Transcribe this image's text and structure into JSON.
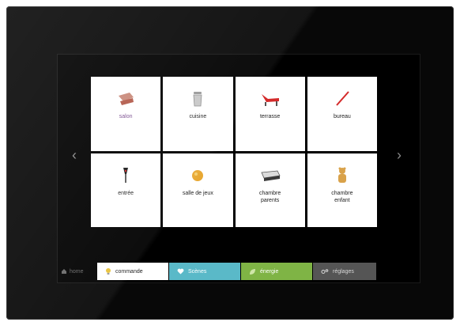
{
  "home": {
    "label": "home"
  },
  "tiles": [
    {
      "label": "salon",
      "icon": "sofa-icon"
    },
    {
      "label": "cuisine",
      "icon": "trash-bin-icon"
    },
    {
      "label": "terrasse",
      "icon": "lounge-chair-icon"
    },
    {
      "label": "bureau",
      "icon": "pen-icon"
    },
    {
      "label": "entrée",
      "icon": "coat-hanger-icon"
    },
    {
      "label": "salle de jeux",
      "icon": "toy-icon"
    },
    {
      "label": "chambre\nparents",
      "icon": "bed-icon"
    },
    {
      "label": "chambre\nenfant",
      "icon": "teddy-bear-icon"
    }
  ],
  "tabs": [
    {
      "label": "commande",
      "icon": "bulb-icon"
    },
    {
      "label": "Scènes",
      "icon": "heart-icon"
    },
    {
      "label": "énergie",
      "icon": "leaf-icon"
    },
    {
      "label": "réglages",
      "icon": "settings-icon"
    }
  ],
  "colors": {
    "scenes": "#5ab9c8",
    "energie": "#7fb445",
    "reglages": "#555555"
  }
}
